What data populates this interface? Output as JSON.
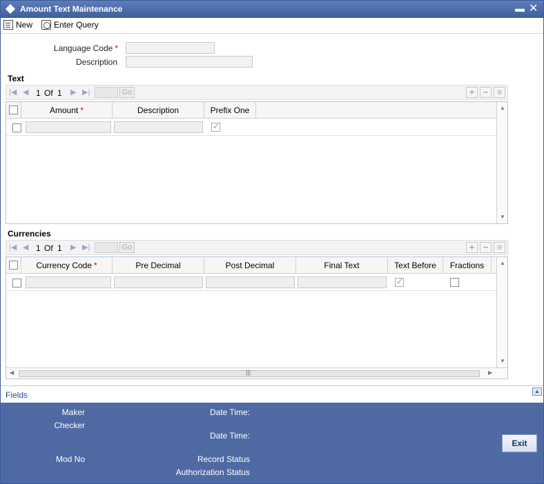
{
  "window": {
    "title": "Amount Text Maintenance"
  },
  "toolbar": {
    "new_label": "New",
    "enter_query_label": "Enter Query"
  },
  "form": {
    "language_code_label": "Language Code",
    "language_code_value": "",
    "description_label": "Description",
    "description_value": ""
  },
  "text_section": {
    "title": "Text",
    "nav": {
      "page": "1",
      "of_label": "Of",
      "total": "1",
      "go_label": "Go"
    },
    "columns": [
      "Amount",
      "Description",
      "Prefix One"
    ],
    "rows": [
      {
        "amount": "",
        "description": "",
        "prefix_one": true
      }
    ]
  },
  "currencies_section": {
    "title": "Currencies",
    "nav": {
      "page": "1",
      "of_label": "Of",
      "total": "1",
      "go_label": "Go"
    },
    "columns": [
      "Currency Code",
      "Pre Decimal",
      "Post Decimal",
      "Final Text",
      "Text Before",
      "Fractions"
    ],
    "rows": [
      {
        "currency_code": "",
        "pre_decimal": "",
        "post_decimal": "",
        "final_text": "",
        "text_before": true,
        "fractions": false
      }
    ]
  },
  "fields_bar": {
    "label": "Fields"
  },
  "footer": {
    "maker_label": "Maker",
    "checker_label": "Checker",
    "date_time_label": "Date Time:",
    "mod_no_label": "Mod No",
    "record_status_label": "Record Status",
    "authorization_status_label": "Authorization Status",
    "exit_label": "Exit"
  },
  "colors": {
    "header_blue": "#3e5f9e",
    "footer_blue": "#4f6aa3",
    "required_red": "#cc0000",
    "link_blue": "#234b95"
  }
}
